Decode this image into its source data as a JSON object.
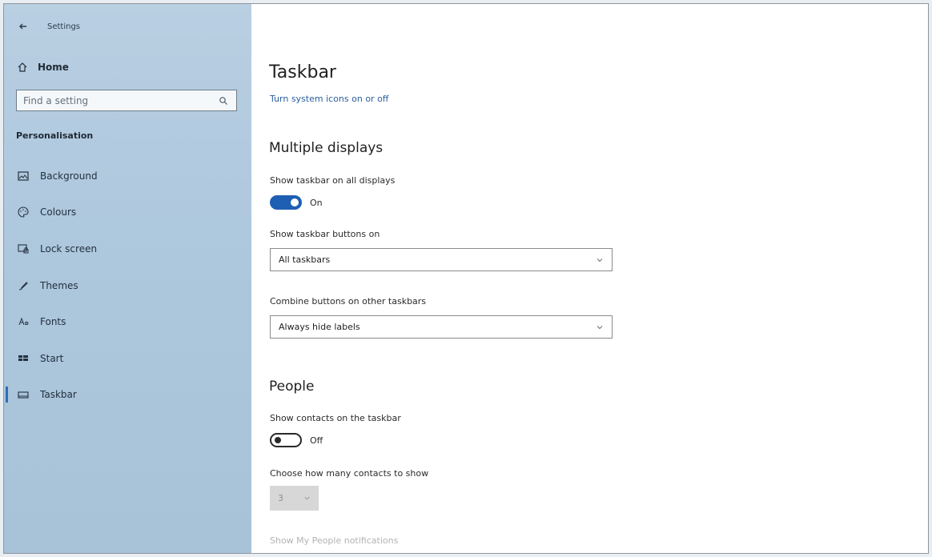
{
  "app": {
    "title": "Settings"
  },
  "sidebar": {
    "home": "Home",
    "search_placeholder": "Find a setting",
    "section": "Personalisation",
    "items": [
      {
        "label": "Background",
        "icon": "image-icon"
      },
      {
        "label": "Colours",
        "icon": "palette-icon"
      },
      {
        "label": "Lock screen",
        "icon": "lock-screen-icon"
      },
      {
        "label": "Themes",
        "icon": "brush-icon"
      },
      {
        "label": "Fonts",
        "icon": "font-icon"
      },
      {
        "label": "Start",
        "icon": "start-icon"
      },
      {
        "label": "Taskbar",
        "icon": "taskbar-icon",
        "selected": true
      }
    ]
  },
  "content": {
    "title": "Taskbar",
    "link": "Turn system icons on or off",
    "multiple_displays": {
      "heading": "Multiple displays",
      "show_all_label": "Show taskbar on all displays",
      "show_all_state": "On",
      "buttons_on_label": "Show taskbar buttons on",
      "buttons_on_value": "All taskbars",
      "combine_label": "Combine buttons on other taskbars",
      "combine_value": "Always hide labels"
    },
    "people": {
      "heading": "People",
      "show_contacts_label": "Show contacts on the taskbar",
      "show_contacts_state": "Off",
      "count_label": "Choose how many contacts to show",
      "count_value": "3",
      "notifications_label": "Show My People notifications"
    }
  },
  "colors": {
    "accent": "#1e5fb3",
    "sidebar_background": "#adc7dd",
    "link": "#2b5f9e"
  }
}
